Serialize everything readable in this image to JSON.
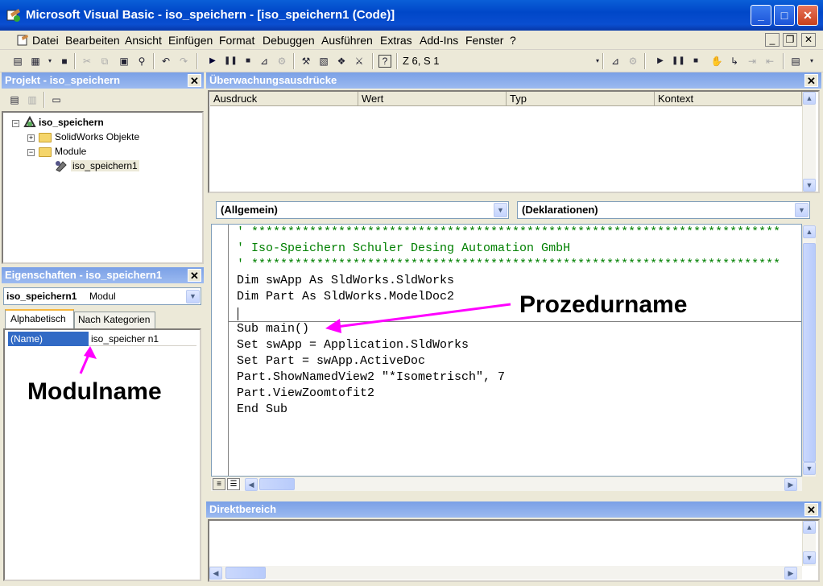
{
  "window": {
    "title": "Microsoft Visual Basic - iso_speichern - [iso_speichern1 (Code)]"
  },
  "menu": [
    "Datei",
    "Bearbeiten",
    "Ansicht",
    "Einfügen",
    "Format",
    "Debuggen",
    "Ausführen",
    "Extras",
    "Add-Ins",
    "Fenster",
    "?"
  ],
  "toolbar": {
    "position": "Z 6, S 1"
  },
  "project": {
    "title": "Projekt - iso_speichern",
    "tree": {
      "root": "iso_speichern",
      "solidworks": "SolidWorks Objekte",
      "module": "Module",
      "module_item": "iso_speichern1"
    }
  },
  "properties": {
    "title": "Eigenschaften - iso_speichern1",
    "object_name": "iso_speichern1",
    "object_type": "Modul",
    "tabs": [
      "Alphabetisch",
      "Nach Kategorien"
    ],
    "rows": [
      {
        "name": "(Name)",
        "value": "iso_speicher n1"
      }
    ]
  },
  "watch": {
    "title": "Überwachungsausdrücke",
    "columns": [
      "Ausdruck",
      "Wert",
      "Typ",
      "Kontext"
    ]
  },
  "code": {
    "object_combo": "(Allgemein)",
    "procedure_combo": "(Deklarationen)",
    "lines": [
      "' *************************************************************************",
      "' Iso-Speichern Schuler Desing Automation GmbH",
      "' *************************************************************************",
      "Dim swApp As SldWorks.SldWorks",
      "Dim Part As SldWorks.ModelDoc2",
      "",
      "Sub main()",
      "Set swApp = Application.SldWorks",
      "Set Part = swApp.ActiveDoc",
      "Part.ShowNamedView2 \"*Isometrisch\", 7",
      "Part.ViewZoomtofit2",
      "End Sub"
    ]
  },
  "immediate": {
    "title": "Direktbereich"
  },
  "annotations": {
    "procedure": "Prozedurname",
    "module": "Modulname"
  },
  "colors": {
    "title_bar": "#0a4ed0",
    "panel_title": "#7aa0e6",
    "comment": "#008000",
    "arrow": "#ff00ff"
  }
}
